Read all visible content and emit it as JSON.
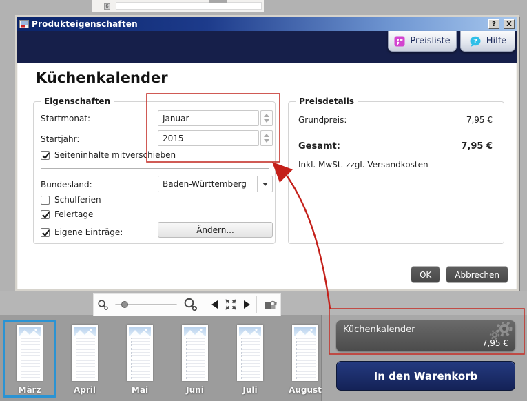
{
  "colors": {
    "titlebar_gradient_start": "#0a246a",
    "titlebar_gradient_end": "#a8c8ee",
    "header_band": "#161f4a",
    "annotation_red": "#c4271f",
    "selection_blue": "#2b93d3",
    "cart_button_navy": "#1b2d6b"
  },
  "background_app": {
    "row_number": "6"
  },
  "dialog": {
    "title": "Produkteigenschaften",
    "window_buttons": {
      "help": "?",
      "close": "X"
    },
    "header_buttons": {
      "preisliste": "Preisliste",
      "hilfe": "Hilfe"
    },
    "product_title": "Küchenkalender",
    "properties_group": {
      "legend": "Eigenschaften",
      "startmonat_label": "Startmonat:",
      "startmonat_value": "Januar",
      "startjahr_label": "Startjahr:",
      "startjahr_value": "2015",
      "seiteninhalte_label": "Seiteninhalte mitverschieben",
      "seiteninhalte_checked": true,
      "bundesland_label": "Bundesland:",
      "bundesland_value": "Baden-Württemberg",
      "schulferien_label": "Schulferien",
      "schulferien_checked": false,
      "feiertage_label": "Feiertage",
      "feiertage_checked": true,
      "eigene_label": "Eigene Einträge:",
      "eigene_checked": true,
      "aendern_button": "Ändern..."
    },
    "price_group": {
      "legend": "Preisdetails",
      "grundpreis_label": "Grundpreis:",
      "grundpreis_value": "7,95 €",
      "gesamt_label": "Gesamt:",
      "gesamt_value": "7,95 €",
      "tax_note": "Inkl. MwSt. zzgl. Versandkosten"
    },
    "ok_button": "OK",
    "cancel_button": "Abbrechen"
  },
  "toolbar": {
    "icons": [
      "zoom-out",
      "zoom-slider",
      "zoom-in",
      "previous-page",
      "fit-to-window",
      "next-page",
      "rotate-page"
    ]
  },
  "preview": {
    "thumbnails": [
      {
        "label": "März",
        "selected": true
      },
      {
        "label": "April",
        "selected": false
      },
      {
        "label": "Mai",
        "selected": false
      },
      {
        "label": "Juni",
        "selected": false
      },
      {
        "label": "Juli",
        "selected": false
      },
      {
        "label": "August",
        "selected": false
      }
    ]
  },
  "cart_panel": {
    "product_name": "Küchenkalender",
    "price": "7,95 €",
    "add_to_cart": "In den Warenkorb"
  }
}
